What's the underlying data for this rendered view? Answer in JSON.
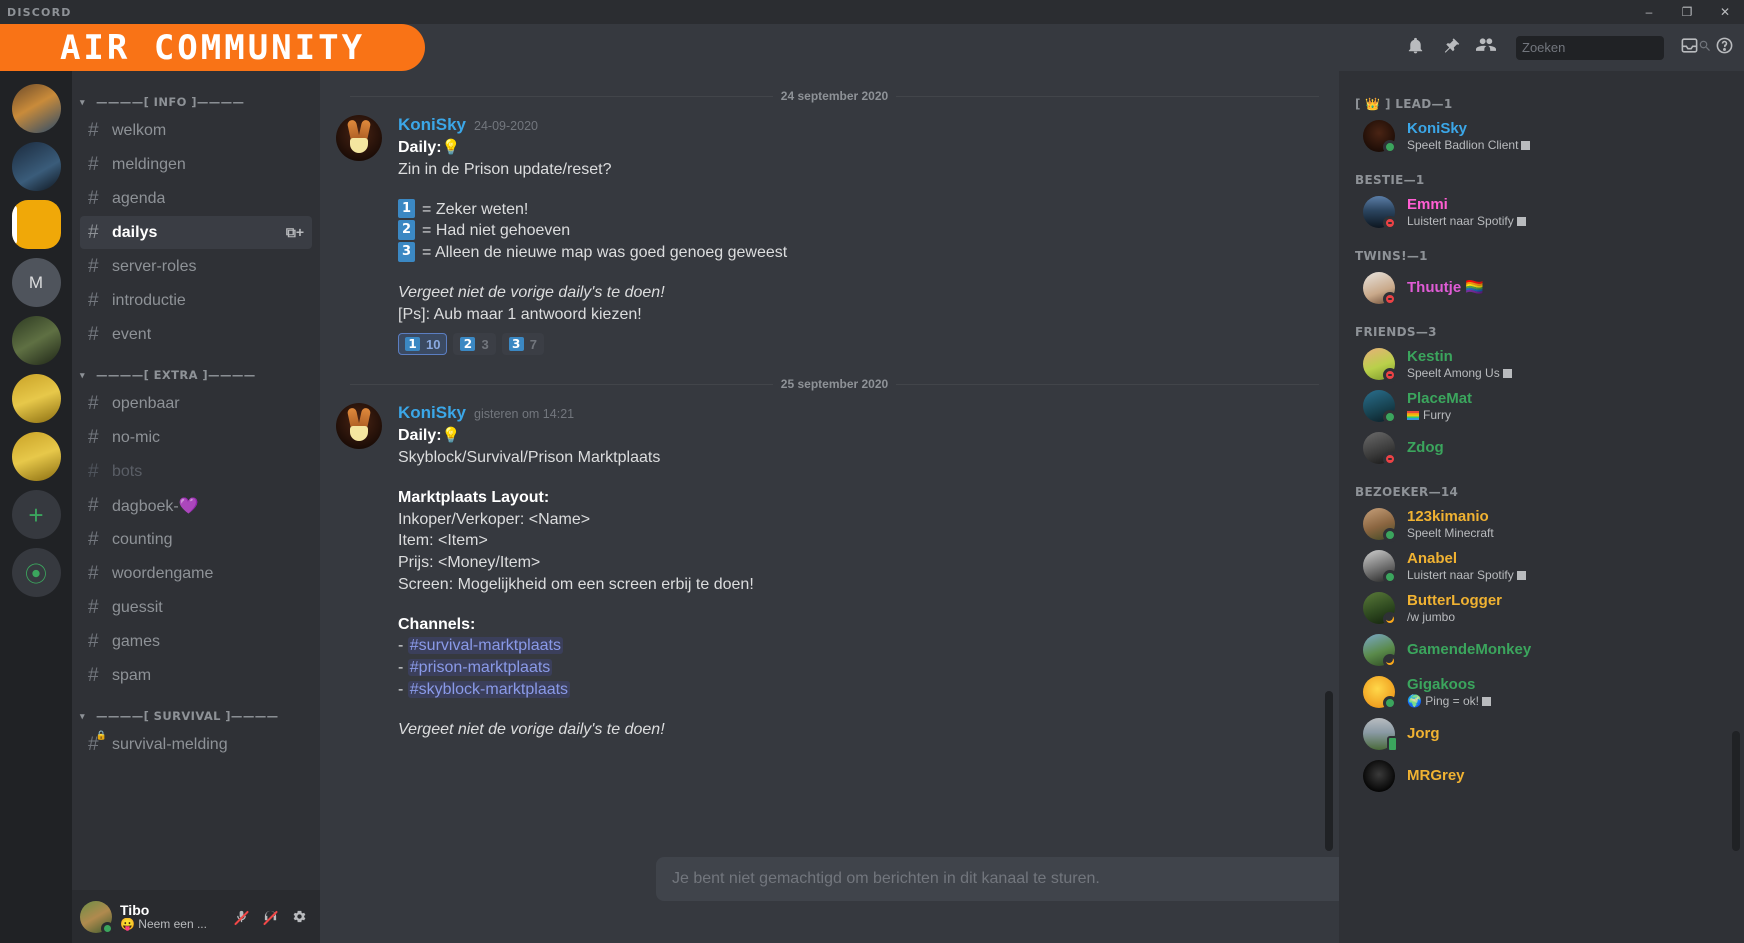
{
  "window": {
    "app_name": "DISCORD",
    "minimize": "–",
    "maximize": "❐",
    "close": "✕"
  },
  "banner": {
    "text": "AIR COMMUNITY"
  },
  "guilds": [
    {
      "name": "guild-1",
      "label": ""
    },
    {
      "name": "guild-2",
      "label": ""
    },
    {
      "name": "guild-air",
      "label": ""
    },
    {
      "name": "guild-m",
      "label": "M"
    },
    {
      "name": "guild-5",
      "label": ""
    },
    {
      "name": "guild-6",
      "label": ""
    },
    {
      "name": "guild-7",
      "label": ""
    },
    {
      "name": "add-server",
      "label": "+"
    },
    {
      "name": "explore-servers",
      "label": "⦿"
    }
  ],
  "sidebar": {
    "categories": [
      {
        "label": "————[ INFO ]————",
        "channels": [
          {
            "name": "welkom",
            "state": "normal"
          },
          {
            "name": "meldingen",
            "state": "normal"
          },
          {
            "name": "agenda",
            "state": "normal"
          },
          {
            "name": "dailys",
            "state": "active",
            "action": "⧉+"
          },
          {
            "name": "server-roles",
            "state": "normal"
          },
          {
            "name": "introductie",
            "state": "normal"
          },
          {
            "name": "event",
            "state": "normal"
          }
        ]
      },
      {
        "label": "————[ EXTRA ]————",
        "channels": [
          {
            "name": "openbaar",
            "state": "normal"
          },
          {
            "name": "no-mic",
            "state": "normal"
          },
          {
            "name": "bots",
            "state": "muted"
          },
          {
            "name": "dagboek-💜",
            "state": "normal"
          },
          {
            "name": "counting",
            "state": "normal"
          },
          {
            "name": "woordengame",
            "state": "normal"
          },
          {
            "name": "guessit",
            "state": "normal"
          },
          {
            "name": "games",
            "state": "normal"
          },
          {
            "name": "spam",
            "state": "normal"
          }
        ]
      },
      {
        "label": "————[ SURVIVAL ]————",
        "channels": [
          {
            "name": "survival-melding",
            "state": "locked"
          }
        ]
      }
    ],
    "user": {
      "name": "Tibo",
      "status": "😛 Neem een ...",
      "mute_icon": "mic-muted-icon",
      "deafen_icon": "headphones-muted-icon",
      "settings_icon": "gear-icon"
    }
  },
  "topbar": {
    "icons": [
      "bell-icon",
      "pin-icon",
      "members-icon"
    ],
    "search": {
      "placeholder": "Zoeken",
      "value": "",
      "icon": "search-icon"
    },
    "inbox_icon": "inbox-icon",
    "help_icon": "help-icon"
  },
  "messages": {
    "dividers": [
      "24 september 2020",
      "25 september 2020"
    ],
    "items": [
      {
        "author": "KoniSky",
        "timestamp": "24-09-2020",
        "lines": [
          {
            "type": "bold-label",
            "label": "Daily:",
            "emoji": "💡"
          },
          {
            "type": "text",
            "text": "Zin in de Prison update/reset?"
          },
          {
            "type": "spacer"
          },
          {
            "type": "numbered",
            "num": "1",
            "text": "= Zeker weten!"
          },
          {
            "type": "numbered",
            "num": "2",
            "text": "= Had niet gehoeven"
          },
          {
            "type": "numbered",
            "num": "3",
            "text": "= Alleen de nieuwe map was goed genoeg geweest"
          },
          {
            "type": "spacer"
          },
          {
            "type": "italic",
            "text": "Vergeet niet de vorige daily's te doen!"
          },
          {
            "type": "text",
            "text": "[Ps]: Aub maar 1 antwoord kiezen!"
          }
        ],
        "reactions": [
          {
            "emoji": "1",
            "count": "10",
            "me": true
          },
          {
            "emoji": "2",
            "count": "3",
            "me": false
          },
          {
            "emoji": "3",
            "count": "7",
            "me": false
          }
        ]
      },
      {
        "author": "KoniSky",
        "timestamp": "gisteren om 14:21",
        "lines": [
          {
            "type": "bold-label",
            "label": "Daily:",
            "emoji": "💡"
          },
          {
            "type": "text",
            "text": "Skyblock/Survival/Prison Marktplaats"
          },
          {
            "type": "spacer"
          },
          {
            "type": "bold",
            "text": "Marktplaats Layout:"
          },
          {
            "type": "text",
            "text": "Inkoper/Verkoper: <Name>"
          },
          {
            "type": "text",
            "text": "Item: <Item>"
          },
          {
            "type": "text",
            "text": "Prijs: <Money/Item>"
          },
          {
            "type": "text",
            "text": "Screen: Mogelijkheid om een screen erbij te doen!"
          },
          {
            "type": "spacer"
          },
          {
            "type": "bold",
            "text": "Channels:"
          },
          {
            "type": "channel-link",
            "prefix": "- ",
            "text": "#survival-marktplaats"
          },
          {
            "type": "channel-link",
            "prefix": "- ",
            "text": "#prison-marktplaats"
          },
          {
            "type": "channel-link",
            "prefix": "- ",
            "text": "#skyblock-marktplaats"
          },
          {
            "type": "spacer"
          },
          {
            "type": "italic",
            "text": "Vergeet niet de vorige daily's te doen!"
          }
        ],
        "reactions": []
      }
    ],
    "composer_placeholder": "Je bent niet gemachtigd om berichten in dit kanaal te sturen."
  },
  "memberlist": {
    "groups": [
      {
        "label": "[ 👑 ] LEAD—1",
        "members": [
          {
            "name": "KoniSky",
            "color": "#3ba7e8",
            "activity": "Speelt Badlion Client",
            "activity_badge": true,
            "status": "online",
            "avatar": "bunny"
          }
        ]
      },
      {
        "label": "BESTIE—1",
        "members": [
          {
            "name": "Emmi",
            "color": "#ff5ed2",
            "activity": "Luistert naar Spotify",
            "activity_badge": true,
            "status": "dnd",
            "avatar": "concert"
          }
        ]
      },
      {
        "label": "TWINS!—1",
        "members": [
          {
            "name": "Thuutje",
            "color": "#e05cd6",
            "activity": "",
            "activity_badge": false,
            "status": "dnd",
            "avatar": "anime",
            "name_suffix": "🏳️‍🌈"
          }
        ]
      },
      {
        "label": "FRIENDS—3",
        "members": [
          {
            "name": "Kestin",
            "color": "#3ba55d",
            "activity": "Speelt Among Us",
            "activity_badge": true,
            "status": "dnd",
            "avatar": "cartoon"
          },
          {
            "name": "PlaceMat",
            "color": "#3ba55d",
            "activity": "Furry",
            "activity_flag": true,
            "status": "online",
            "avatar": "wolf"
          },
          {
            "name": "Zdog",
            "color": "#3ba55d",
            "activity": "",
            "status": "dnd",
            "avatar": "gear"
          }
        ]
      },
      {
        "label": "BEZOEKER—14",
        "members": [
          {
            "name": "123kimanio",
            "color": "#f0b232",
            "activity": "Speelt Minecraft",
            "status": "online",
            "avatar": "guinea"
          },
          {
            "name": "Anabel",
            "color": "#f0b232",
            "activity": "Luistert naar Spotify",
            "activity_badge": true,
            "status": "online",
            "avatar": "bw"
          },
          {
            "name": "ButterLogger",
            "color": "#f0b232",
            "activity": "/w jumbo",
            "status": "idle",
            "avatar": "forest"
          },
          {
            "name": "GamendeMonkey",
            "color": "#3ba55d",
            "activity": "",
            "status": "idle",
            "avatar": "city"
          },
          {
            "name": "Gigakoos",
            "color": "#3ba55d",
            "activity": "Ping = ok!",
            "activity_globe": true,
            "activity_badge": true,
            "status": "online",
            "avatar": "blob"
          },
          {
            "name": "Jorg",
            "color": "#f0b232",
            "activity": "",
            "status": "mobile",
            "avatar": "sky"
          },
          {
            "name": "MRGrey",
            "color": "#f0b232",
            "activity": "",
            "status": "none",
            "avatar": "dark"
          }
        ]
      }
    ]
  },
  "colors": {
    "accent_orange": "#f97316",
    "brand_blurple": "#5865f2",
    "online": "#3ba55d",
    "dnd": "#ed4245",
    "idle": "#faa81a",
    "link": "#8a9ae8",
    "author": "#3ba7e8"
  }
}
